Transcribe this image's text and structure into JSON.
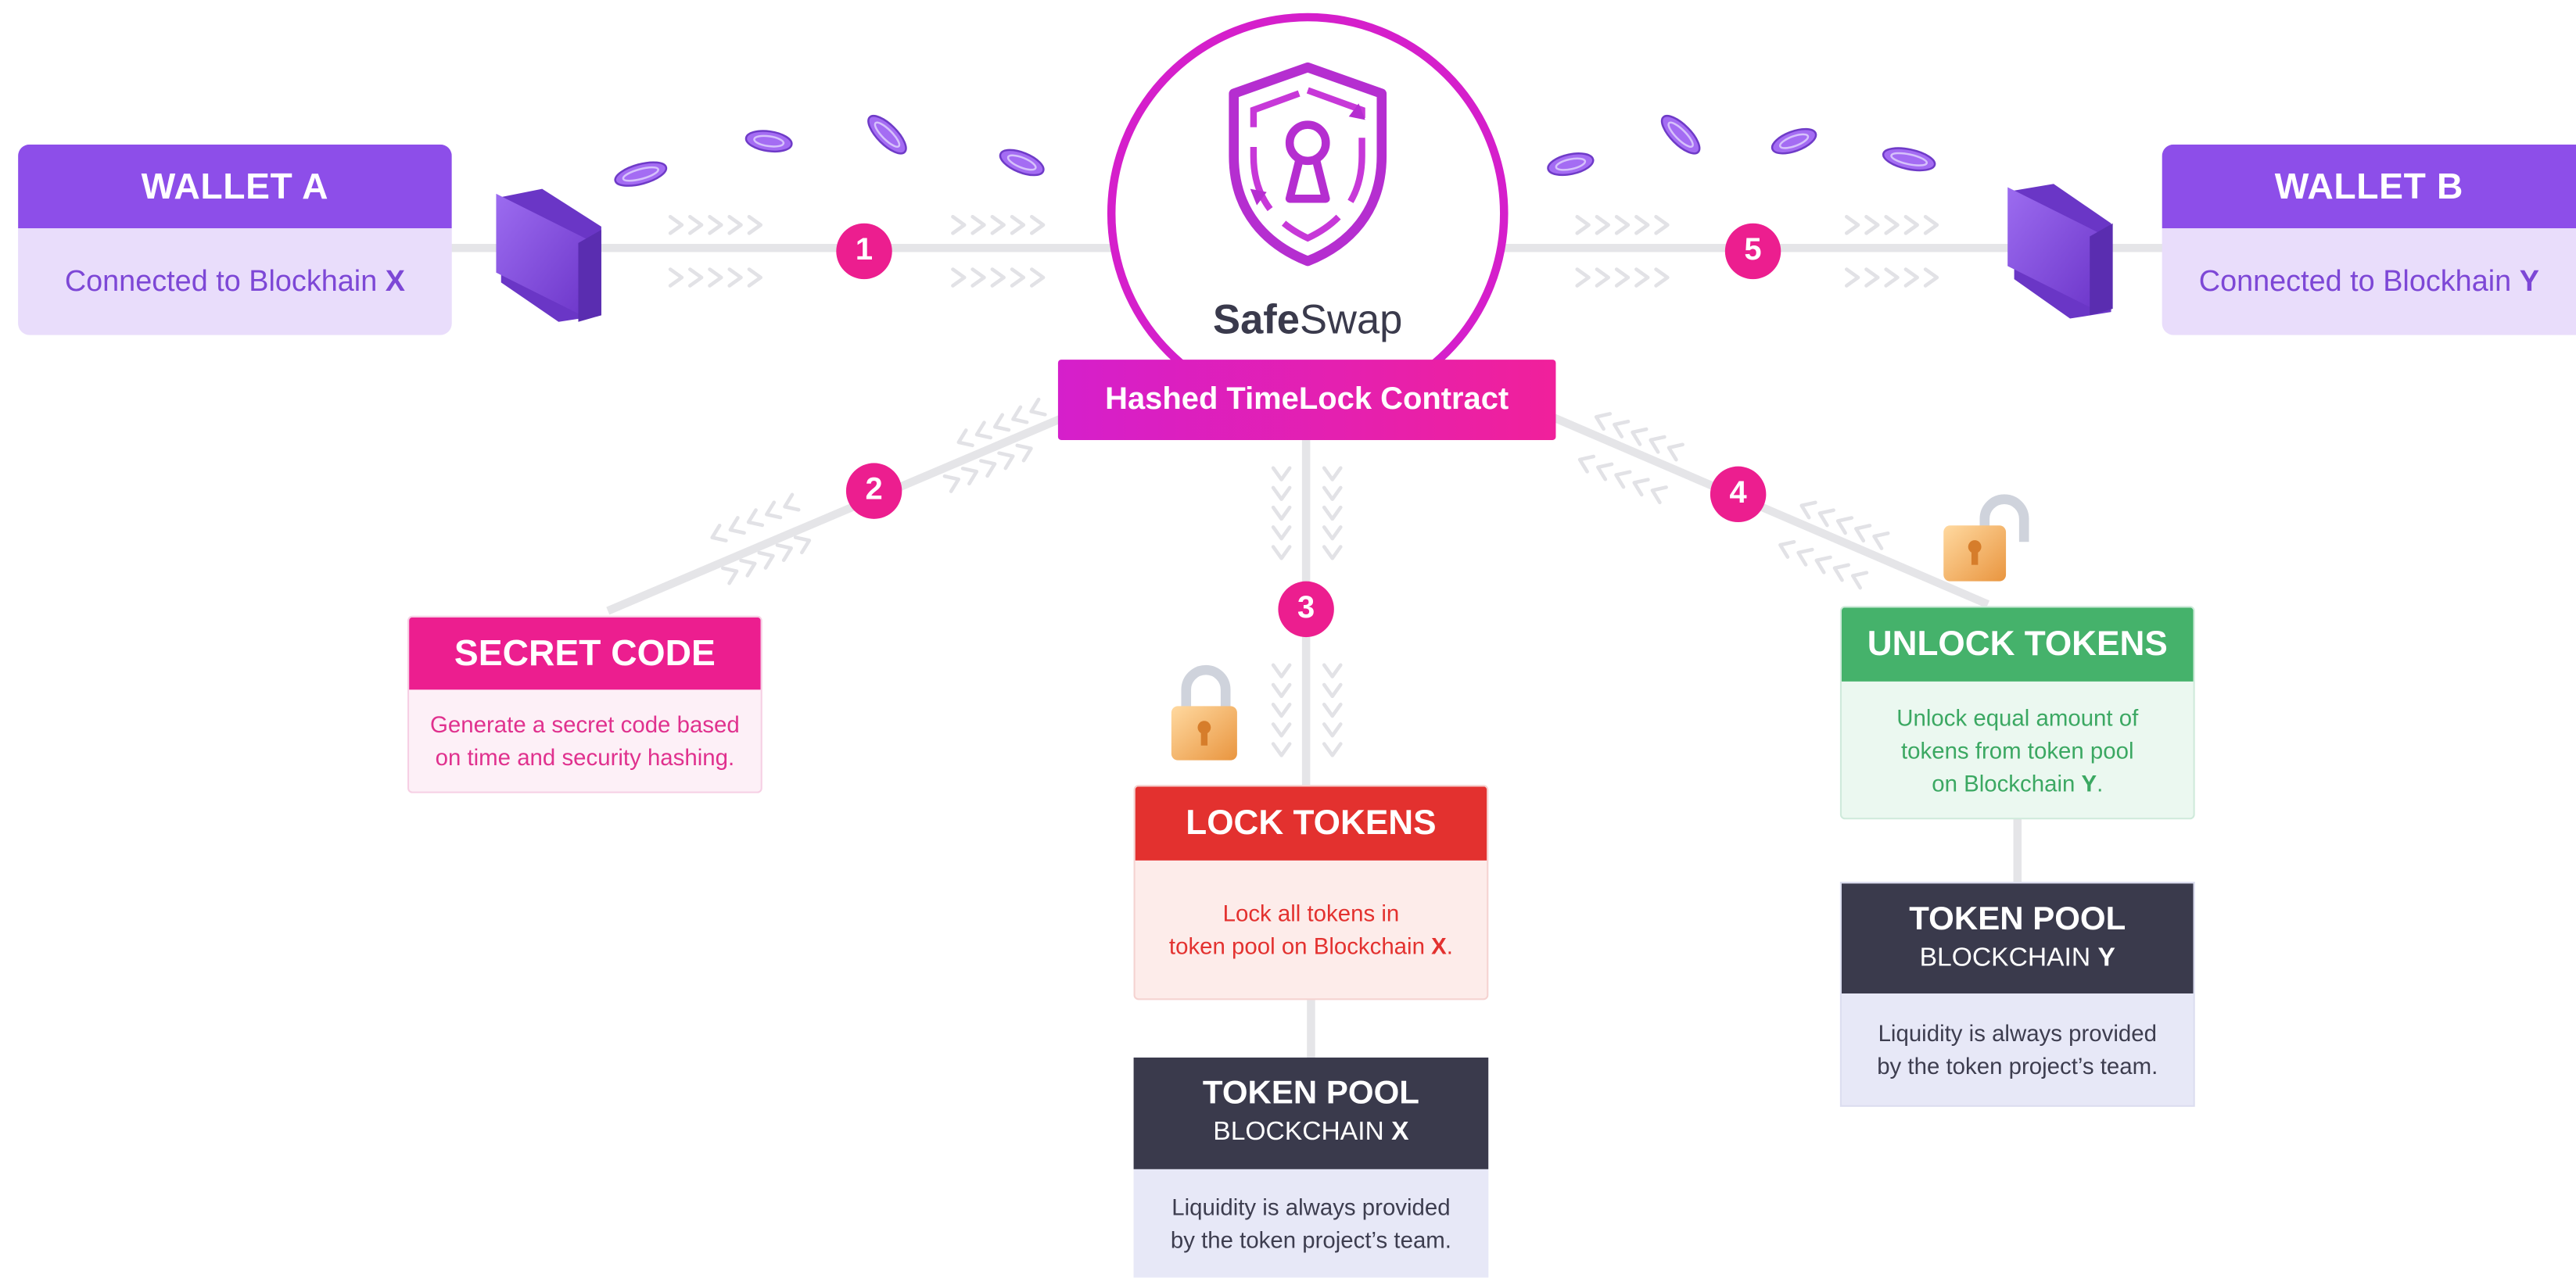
{
  "logo": {
    "name_bold": "Safe",
    "name_rest": "Swap"
  },
  "contract": {
    "label": "Hashed TimeLock Contract"
  },
  "wallet_a": {
    "title": "WALLET A",
    "text": "Connected to Blockhain ",
    "chain": "X"
  },
  "wallet_b": {
    "title": "WALLET B",
    "text": "Connected to Blockhain ",
    "chain": "Y"
  },
  "steps": [
    "1",
    "2",
    "3",
    "4",
    "5"
  ],
  "secret_code": {
    "title": "SECRET CODE",
    "line1": "Generate a secret code based",
    "line2": "on time and security hashing."
  },
  "lock_tokens": {
    "title": "LOCK TOKENS",
    "line1": "Lock all tokens in",
    "line2": "token pool on Blockchain ",
    "chain": "X",
    "end": "."
  },
  "unlock_tokens": {
    "title": "UNLOCK TOKENS",
    "line1": "Unlock equal amount of",
    "line2": "tokens from token pool",
    "line3": "on Blockchain ",
    "chain": "Y",
    "end": "."
  },
  "token_pool_x": {
    "title": "TOKEN POOL",
    "sub": "BLOCKCHAIN ",
    "chain": "X",
    "line1": "Liquidity is always provided",
    "line2": "by the token project’s team."
  },
  "token_pool_y": {
    "title": "TOKEN POOL",
    "sub": "BLOCKCHAIN ",
    "chain": "Y",
    "line1": "Liquidity is always provided",
    "line2": "by the token project’s team."
  },
  "colors": {
    "purple": "#8d4ee9",
    "purple_light": "#e9ddfb",
    "magenta": "#ec1e8f",
    "contract": "#d51fcb",
    "red": "#e3312f",
    "green": "#45b26b",
    "navy": "#3a3a4c"
  },
  "icons": [
    "shield-keyhole-icon",
    "coin-icon",
    "wallet-icon",
    "padlock-locked-icon",
    "padlock-unlocked-icon",
    "chevron-arrows-icon"
  ]
}
